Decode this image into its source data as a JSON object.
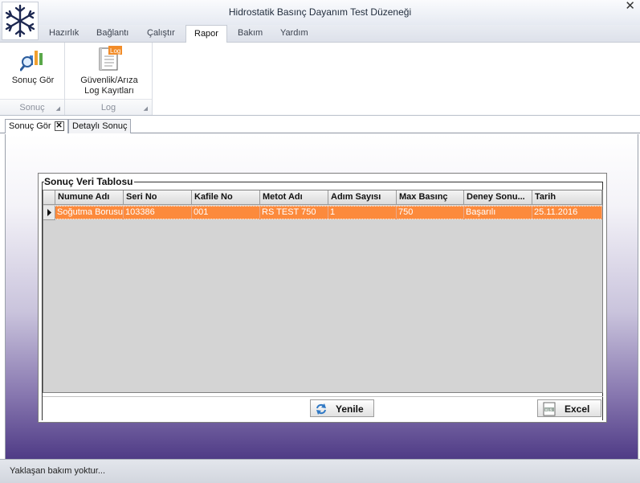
{
  "window": {
    "title": "Hidrostatik Basınç Dayanım Test Düzeneği",
    "close_glyph": "✕"
  },
  "ribbon_tabs": [
    {
      "label": "Hazırlık"
    },
    {
      "label": "Bağlantı"
    },
    {
      "label": "Çalıştır"
    },
    {
      "label": "Rapor"
    },
    {
      "label": "Bakım"
    },
    {
      "label": "Yardım"
    }
  ],
  "active_tab": "Rapor",
  "ribbon_groups": [
    {
      "label": "Sonuç",
      "button": {
        "label": "Sonuç Gör",
        "icon": "magnifier-chart-icon"
      }
    },
    {
      "label": "Log",
      "button": {
        "label_line1": "Güvenlik/Arıza",
        "label_line2": "Log Kayıtları",
        "icon": "log-document-icon",
        "icon_text": "Log"
      }
    }
  ],
  "doc_tabs": [
    {
      "label": "Sonuç Gör",
      "closable": true
    },
    {
      "label": "Detaylı Sonuç",
      "closable": false
    }
  ],
  "panel": {
    "title": "Sonuç Veri Tablosu",
    "columns": [
      "Numune Adı",
      "Seri No",
      "Kafile No",
      "Metot Adı",
      "Adım Sayısı",
      "Max Basınç",
      "Deney Sonu...",
      "Tarih"
    ],
    "rows": [
      [
        "Soğutma Borusu",
        "103386",
        "001",
        "RS TEST 750",
        "1",
        "750",
        "Başarılı",
        "25.11.2016"
      ]
    ],
    "buttons": {
      "refresh": {
        "label": "Yenile",
        "icon": "refresh-icon"
      },
      "excel": {
        "label": "Excel",
        "icon": "excel-file-icon",
        "icon_text": "XLS"
      }
    }
  },
  "status": {
    "text": "Yaklaşan bakım yoktur..."
  },
  "colors": {
    "selected_row": "#fc8a3c",
    "workspace_gradient_end": "#4f3b86",
    "refresh_icon": "#2f78c4"
  }
}
